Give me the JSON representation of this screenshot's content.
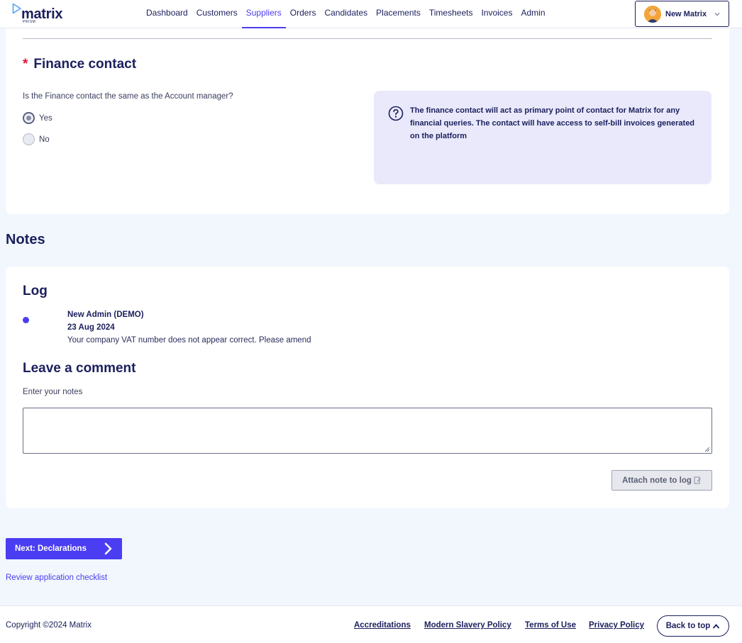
{
  "header": {
    "logo_text": "matrix",
    "logo_sub": "PRISM",
    "nav": [
      {
        "label": "Dashboard",
        "active": false
      },
      {
        "label": "Customers",
        "active": false
      },
      {
        "label": "Suppliers",
        "active": true
      },
      {
        "label": "Orders",
        "active": false
      },
      {
        "label": "Candidates",
        "active": false
      },
      {
        "label": "Placements",
        "active": false
      },
      {
        "label": "Timesheets",
        "active": false
      },
      {
        "label": "Invoices",
        "active": false
      },
      {
        "label": "Admin",
        "active": false
      }
    ],
    "user_name": "New Matrix",
    "user_icon": "avatar-icon",
    "accent_color": "#4b3df2"
  },
  "finance": {
    "required_mark": "*",
    "title": "Finance contact",
    "question": "Is the Finance contact the same as the Account manager?",
    "options": [
      {
        "label": "Yes",
        "checked": true
      },
      {
        "label": "No",
        "checked": false
      }
    ],
    "info_icon": "question-circle-icon",
    "info_text": "The finance contact will act as primary point of contact for Matrix for any financial queries. The contact will have access to self-bill invoices generated on the platform"
  },
  "notes": {
    "heading": "Notes",
    "log_title": "Log",
    "entries": [
      {
        "author": "New Admin (DEMO)",
        "date": "23 Aug 2024",
        "message": "Your company VAT number does not appear correct. Please amend"
      }
    ],
    "comment_title": "Leave a comment",
    "notes_label": "Enter your notes",
    "notes_value": "",
    "attach_label": "Attach note to log"
  },
  "actions": {
    "next_label": "Next: Declarations",
    "review_link": "Review application checklist"
  },
  "footer": {
    "copyright": "Copyright ©2024 Matrix",
    "links": [
      "Accreditations",
      "Modern Slavery Policy",
      "Terms of Use",
      "Privacy Policy"
    ],
    "back_to_top": "Back to top"
  }
}
